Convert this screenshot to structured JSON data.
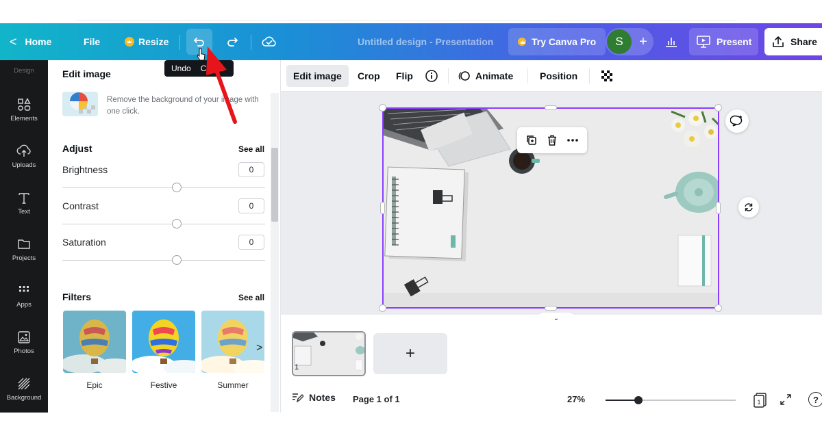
{
  "topbar": {
    "home_label": "Home",
    "file_label": "File",
    "resize_label": "Resize",
    "doc_title": "Untitled design - Presentation",
    "try_pro_label": "Try Canva Pro",
    "avatar_initial": "S",
    "present_label": "Present",
    "share_label": "Share"
  },
  "tooltip": {
    "label": "Undo",
    "shortcut": "Ctrl+Z"
  },
  "rail": {
    "items": [
      {
        "label": "Design",
        "icon": "design-icon"
      },
      {
        "label": "Elements",
        "icon": "elements-icon"
      },
      {
        "label": "Uploads",
        "icon": "upload-icon"
      },
      {
        "label": "Text",
        "icon": "text-icon"
      },
      {
        "label": "Projects",
        "icon": "folder-icon"
      },
      {
        "label": "Apps",
        "icon": "apps-grid-icon"
      },
      {
        "label": "Photos",
        "icon": "photo-icon"
      },
      {
        "label": "Background",
        "icon": "background-pattern-icon"
      }
    ]
  },
  "panel": {
    "title": "Edit image",
    "bg_remover_desc": "Remove the background of your image with one click.",
    "adjust_title": "Adjust",
    "adjust_see_all": "See all",
    "sliders": [
      {
        "label": "Brightness",
        "value": "0"
      },
      {
        "label": "Contrast",
        "value": "0"
      },
      {
        "label": "Saturation",
        "value": "0"
      }
    ],
    "filters_title": "Filters",
    "filters_see_all": "See all",
    "filters": [
      {
        "label": "Epic"
      },
      {
        "label": "Festive"
      },
      {
        "label": "Summer"
      }
    ]
  },
  "edit_toolbar": {
    "edit_image": "Edit image",
    "crop": "Crop",
    "flip": "Flip",
    "animate": "Animate",
    "position": "Position"
  },
  "pages": {
    "page_number": "1",
    "add_page": "+",
    "notes_label": "Notes",
    "page_of": "Page 1 of 1",
    "zoom": "27%",
    "zoom_fraction": 0.25,
    "page_count_badge": "1",
    "help": "?"
  },
  "colors": {
    "accent": "#8b3dff",
    "rail_bg": "#18191b",
    "avatar_bg": "#2f7d32",
    "arrow_red": "#e8141c"
  }
}
